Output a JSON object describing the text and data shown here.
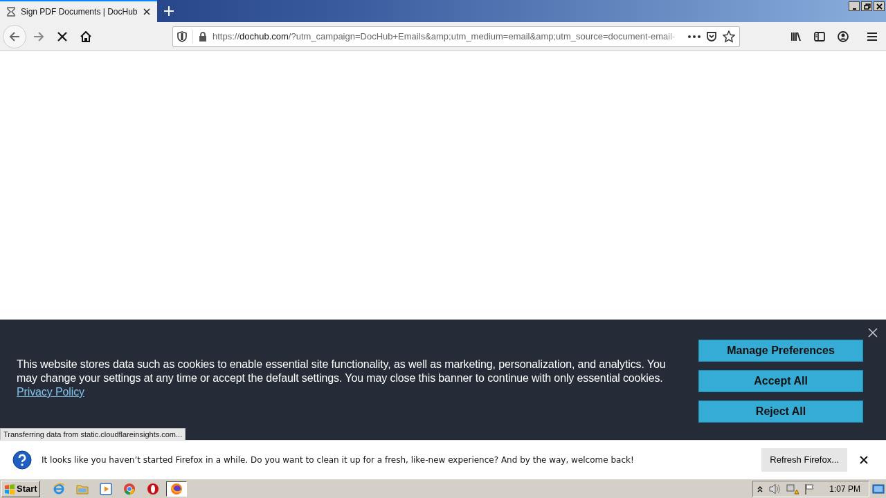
{
  "tabs": [
    {
      "title": "Sign PDF Documents | DocHub",
      "selected": true
    }
  ],
  "toolbar": {
    "loading": true,
    "address": {
      "prefix": "https://",
      "host": "dochub.com",
      "path": "/?utm_campaign=DocHub+Emails&amp;utm_medium=email&amp;utm_source=document-email-"
    }
  },
  "cookie_banner": {
    "text": "This website stores data such as cookies to enable essential site functionality, as well as marketing, personalization, and analytics. You may change your settings at any time or accept the default settings. You may close this banner to continue with only essential cookies.",
    "link": "Privacy Policy",
    "buttons": [
      "Manage Preferences",
      "Accept All",
      "Reject All"
    ]
  },
  "status": "Transferring data from static.cloudflareinsights.com...",
  "notification": {
    "text": "It looks like you haven’t started Firefox in a while. Do you want to clean it up for a fresh, like-new experience? And by the way, welcome back!",
    "button": "Refresh Firefox..."
  },
  "taskbar": {
    "start": "Start",
    "apps": [
      {
        "kind": "ie",
        "active": false
      },
      {
        "kind": "folder",
        "active": false
      },
      {
        "kind": "media",
        "active": false
      },
      {
        "kind": "chrome",
        "active": false
      },
      {
        "kind": "opera",
        "active": false
      },
      {
        "kind": "firefox",
        "active": true
      }
    ],
    "clock": "1:07 PM"
  }
}
